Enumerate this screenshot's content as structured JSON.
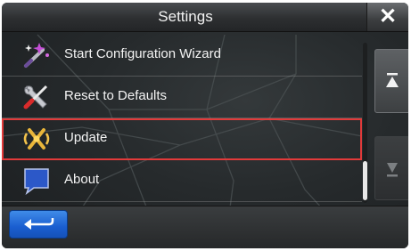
{
  "header": {
    "title": "Settings",
    "close_icon": "close-icon"
  },
  "menu": {
    "items": [
      {
        "label": "Start Configuration Wizard",
        "icon": "wizard-wand-icon",
        "highlighted": false
      },
      {
        "label": "Reset to Defaults",
        "icon": "wrench-screwdriver-icon",
        "highlighted": false
      },
      {
        "label": "Update",
        "icon": "update-signal-icon",
        "highlighted": true
      },
      {
        "label": "About",
        "icon": "chat-bubble-icon",
        "highlighted": false
      }
    ]
  },
  "scroll": {
    "up_icon": "scroll-to-top-icon",
    "down_icon": "scroll-to-bottom-icon"
  },
  "footer": {
    "back_icon": "back-arrow-icon"
  },
  "colors": {
    "highlight_border": "#e23a3a",
    "back_button": "#1a5ed0",
    "header": "#2d2f31"
  }
}
